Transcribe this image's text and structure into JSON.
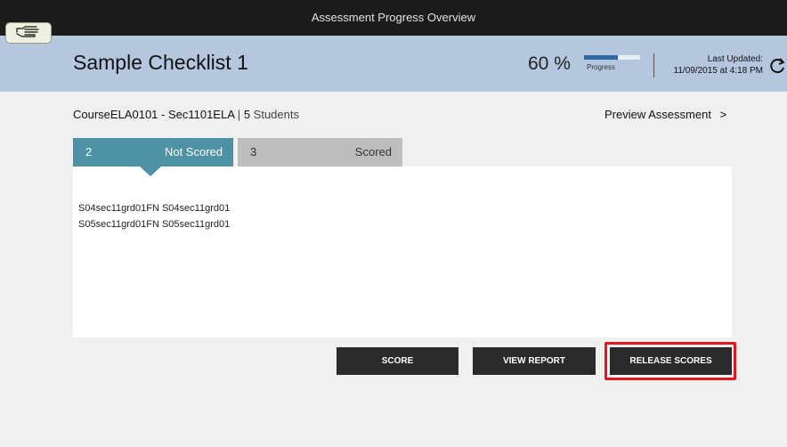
{
  "window": {
    "title": "Assessment Progress Overview"
  },
  "header": {
    "checklist_title": "Sample Checklist 1",
    "progress_percent_text": "60 %",
    "progress_value": 0.6,
    "progress_label": "Progress",
    "last_updated_label": "Last Updated:",
    "last_updated_value": "11/09/2015 at 4:18 PM"
  },
  "course": {
    "name": "CourseELA0101 - Sec1101ELA",
    "separator": "|",
    "student_count": "5",
    "students_label": "Students"
  },
  "preview_link": {
    "label": "Preview Assessment",
    "chevron": ">"
  },
  "tabs": [
    {
      "count": "2",
      "label": "Not Scored",
      "active": true
    },
    {
      "count": "3",
      "label": "Scored",
      "active": false
    }
  ],
  "students": [
    "S04sec11grd01FN S04sec11grd01",
    "S05sec11grd01FN S05sec11grd01"
  ],
  "buttons": {
    "score": "SCORE",
    "view_report": "VIEW REPORT",
    "release_scores": "RELEASE SCORES"
  },
  "colors": {
    "topbar": "#1c1c1c",
    "header": "#b4c7df",
    "tab_active": "#4d93a5",
    "tab_inactive": "#bdbdbd",
    "button": "#2a2a2a",
    "highlight": "#e3141f"
  },
  "icons": [
    "hand-pointer-icon",
    "refresh-icon",
    "chevron-right-icon"
  ]
}
